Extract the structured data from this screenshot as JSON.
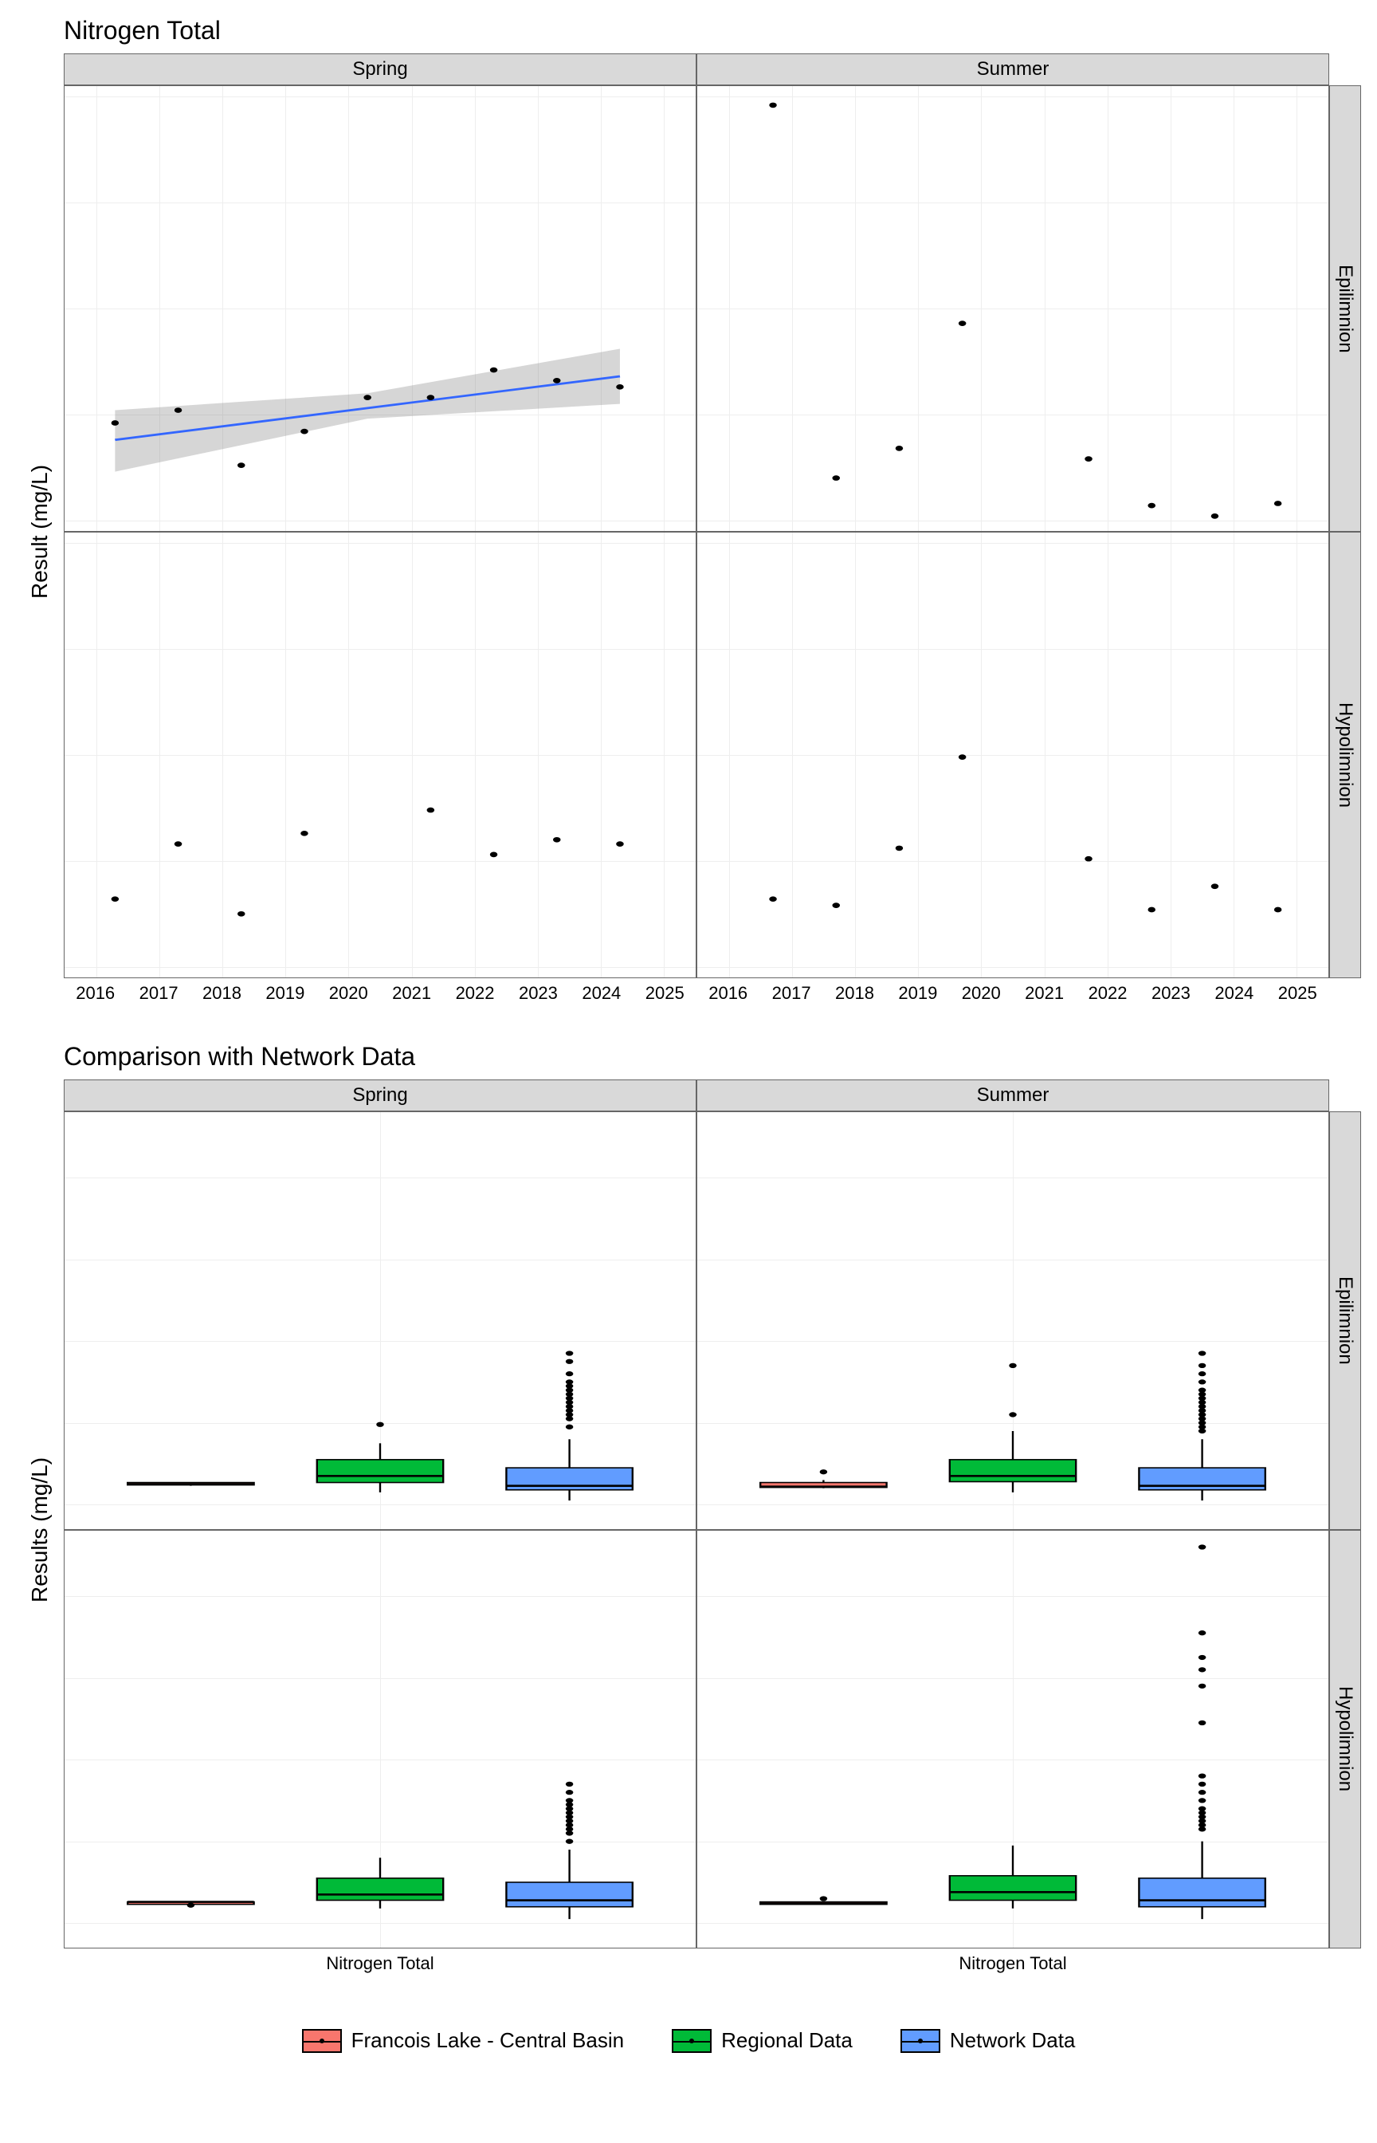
{
  "chart_data": [
    {
      "type": "scatter",
      "title": "Nitrogen Total",
      "xlabel": "",
      "ylabel": "Result (mg/L)",
      "x_range": [
        2015.5,
        2025.5
      ],
      "y_range": [
        0.195,
        0.405
      ],
      "x_ticks": [
        2016,
        2017,
        2018,
        2019,
        2020,
        2021,
        2022,
        2023,
        2024,
        2025
      ],
      "y_ticks": [
        0.2,
        0.25,
        0.3,
        0.35,
        0.4
      ],
      "facet_cols": [
        "Spring",
        "Summer"
      ],
      "facet_rows": [
        "Epilimnion",
        "Hypolimnion"
      ],
      "panels": [
        {
          "row": "Epilimnion",
          "col": "Spring",
          "points": [
            {
              "x": 2016.3,
              "y": 0.246
            },
            {
              "x": 2017.3,
              "y": 0.252
            },
            {
              "x": 2018.3,
              "y": 0.226
            },
            {
              "x": 2019.3,
              "y": 0.242
            },
            {
              "x": 2020.3,
              "y": 0.258
            },
            {
              "x": 2021.3,
              "y": 0.258
            },
            {
              "x": 2022.3,
              "y": 0.271
            },
            {
              "x": 2023.3,
              "y": 0.266
            },
            {
              "x": 2024.3,
              "y": 0.263
            }
          ],
          "trend": {
            "x0": 2016.3,
            "y0": 0.238,
            "x1": 2024.3,
            "y1": 0.268,
            "ci": [
              [
                2016.3,
                0.223,
                0.252
              ],
              [
                2020.3,
                0.248,
                0.26
              ],
              [
                2024.3,
                0.255,
                0.281
              ]
            ]
          }
        },
        {
          "row": "Epilimnion",
          "col": "Summer",
          "points": [
            {
              "x": 2016.7,
              "y": 0.396
            },
            {
              "x": 2017.7,
              "y": 0.22
            },
            {
              "x": 2018.7,
              "y": 0.234
            },
            {
              "x": 2019.7,
              "y": 0.293
            },
            {
              "x": 2021.7,
              "y": 0.229
            },
            {
              "x": 2022.7,
              "y": 0.207
            },
            {
              "x": 2023.7,
              "y": 0.202
            },
            {
              "x": 2024.7,
              "y": 0.208
            }
          ]
        },
        {
          "row": "Hypolimnion",
          "col": "Spring",
          "points": [
            {
              "x": 2016.3,
              "y": 0.232
            },
            {
              "x": 2017.3,
              "y": 0.258
            },
            {
              "x": 2018.3,
              "y": 0.225
            },
            {
              "x": 2019.3,
              "y": 0.263
            },
            {
              "x": 2021.3,
              "y": 0.274
            },
            {
              "x": 2022.3,
              "y": 0.253
            },
            {
              "x": 2023.3,
              "y": 0.26
            },
            {
              "x": 2024.3,
              "y": 0.258
            }
          ]
        },
        {
          "row": "Hypolimnion",
          "col": "Summer",
          "points": [
            {
              "x": 2016.7,
              "y": 0.232
            },
            {
              "x": 2017.7,
              "y": 0.229
            },
            {
              "x": 2018.7,
              "y": 0.256
            },
            {
              "x": 2019.7,
              "y": 0.299
            },
            {
              "x": 2021.7,
              "y": 0.251
            },
            {
              "x": 2022.7,
              "y": 0.227
            },
            {
              "x": 2023.7,
              "y": 0.238
            },
            {
              "x": 2024.7,
              "y": 0.227
            }
          ]
        }
      ]
    },
    {
      "type": "boxplot",
      "title": "Comparison with Network Data",
      "xlabel": "Nitrogen Total",
      "ylabel": "Results (mg/L)",
      "y_range": [
        -0.3,
        4.8
      ],
      "y_ticks": [
        0,
        1,
        2,
        3,
        4
      ],
      "facet_cols": [
        "Spring",
        "Summer"
      ],
      "facet_rows": [
        "Epilimnion",
        "Hypolimnion"
      ],
      "categories": [
        "Francois Lake - Central Basin",
        "Regional Data",
        "Network Data"
      ],
      "colors": {
        "Francois Lake - Central Basin": "#F8766D",
        "Regional Data": "#00BA38",
        "Network Data": "#619CFF"
      },
      "panels": [
        {
          "row": "Epilimnion",
          "col": "Spring",
          "boxes": [
            {
              "cat": "Francois Lake - Central Basin",
              "min": 0.23,
              "q1": 0.24,
              "med": 0.25,
              "q3": 0.27,
              "max": 0.27,
              "out": []
            },
            {
              "cat": "Regional Data",
              "min": 0.15,
              "q1": 0.27,
              "med": 0.35,
              "q3": 0.55,
              "max": 0.75,
              "out": [
                0.98
              ]
            },
            {
              "cat": "Network Data",
              "min": 0.05,
              "q1": 0.18,
              "med": 0.23,
              "q3": 0.45,
              "max": 0.8,
              "out": [
                0.95,
                1.05,
                1.1,
                1.15,
                1.2,
                1.25,
                1.3,
                1.35,
                1.4,
                1.45,
                1.5,
                1.6,
                1.75,
                1.85
              ]
            }
          ]
        },
        {
          "row": "Epilimnion",
          "col": "Summer",
          "boxes": [
            {
              "cat": "Francois Lake - Central Basin",
              "min": 0.2,
              "q1": 0.21,
              "med": 0.22,
              "q3": 0.27,
              "max": 0.3,
              "out": [
                0.4
              ]
            },
            {
              "cat": "Regional Data",
              "min": 0.15,
              "q1": 0.28,
              "med": 0.35,
              "q3": 0.55,
              "max": 0.9,
              "out": [
                1.1,
                1.7
              ]
            },
            {
              "cat": "Network Data",
              "min": 0.05,
              "q1": 0.18,
              "med": 0.23,
              "q3": 0.45,
              "max": 0.8,
              "out": [
                0.9,
                0.95,
                1.0,
                1.05,
                1.1,
                1.15,
                1.2,
                1.25,
                1.3,
                1.35,
                1.4,
                1.5,
                1.6,
                1.7,
                1.85
              ]
            }
          ]
        },
        {
          "row": "Hypolimnion",
          "col": "Spring",
          "boxes": [
            {
              "cat": "Francois Lake - Central Basin",
              "min": 0.22,
              "q1": 0.23,
              "med": 0.26,
              "q3": 0.26,
              "max": 0.27,
              "out": [
                0.22
              ]
            },
            {
              "cat": "Regional Data",
              "min": 0.18,
              "q1": 0.28,
              "med": 0.35,
              "q3": 0.55,
              "max": 0.8,
              "out": []
            },
            {
              "cat": "Network Data",
              "min": 0.05,
              "q1": 0.2,
              "med": 0.28,
              "q3": 0.5,
              "max": 0.9,
              "out": [
                1.0,
                1.1,
                1.15,
                1.2,
                1.25,
                1.3,
                1.35,
                1.4,
                1.45,
                1.5,
                1.6,
                1.7
              ]
            }
          ]
        },
        {
          "row": "Hypolimnion",
          "col": "Summer",
          "boxes": [
            {
              "cat": "Francois Lake - Central Basin",
              "min": 0.23,
              "q1": 0.23,
              "med": 0.24,
              "q3": 0.26,
              "max": 0.26,
              "out": [
                0.3
              ]
            },
            {
              "cat": "Regional Data",
              "min": 0.18,
              "q1": 0.28,
              "med": 0.38,
              "q3": 0.58,
              "max": 0.95,
              "out": []
            },
            {
              "cat": "Network Data",
              "min": 0.05,
              "q1": 0.2,
              "med": 0.28,
              "q3": 0.55,
              "max": 1.0,
              "out": [
                1.15,
                1.2,
                1.25,
                1.3,
                1.35,
                1.4,
                1.5,
                1.6,
                1.7,
                1.8,
                2.45,
                2.9,
                3.1,
                3.25,
                3.55,
                4.6
              ]
            }
          ]
        }
      ]
    }
  ],
  "legend": {
    "items": [
      {
        "label": "Francois Lake - Central Basin",
        "color": "#F8766D"
      },
      {
        "label": "Regional Data",
        "color": "#00BA38"
      },
      {
        "label": "Network Data",
        "color": "#619CFF"
      }
    ]
  }
}
